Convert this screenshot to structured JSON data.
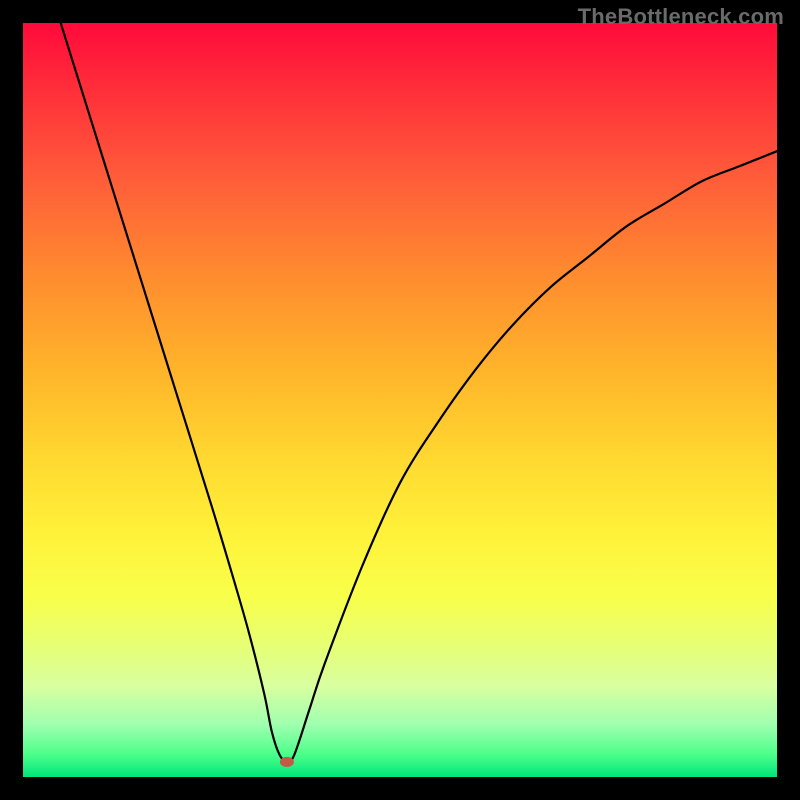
{
  "watermark": "TheBottleneck.com",
  "chart_data": {
    "type": "line",
    "title": "",
    "xlabel": "",
    "ylabel": "",
    "xlim": [
      0,
      100
    ],
    "ylim": [
      0,
      100
    ],
    "series": [
      {
        "name": "bottleneck-curve",
        "x": [
          5,
          10,
          15,
          20,
          25,
          28,
          30,
          32,
          33,
          34,
          35,
          36,
          38,
          40,
          45,
          50,
          55,
          60,
          65,
          70,
          75,
          80,
          85,
          90,
          95,
          100
        ],
        "y": [
          100,
          84,
          68,
          52,
          36,
          26,
          19,
          11,
          6,
          3,
          2,
          3,
          9,
          15,
          28,
          39,
          47,
          54,
          60,
          65,
          69,
          73,
          76,
          79,
          81,
          83
        ]
      }
    ],
    "marker": {
      "x": 35,
      "y": 2
    },
    "grid": false,
    "legend": false
  },
  "colors": {
    "curve": "#000000",
    "marker": "#c25a48",
    "frame": "#000000"
  }
}
